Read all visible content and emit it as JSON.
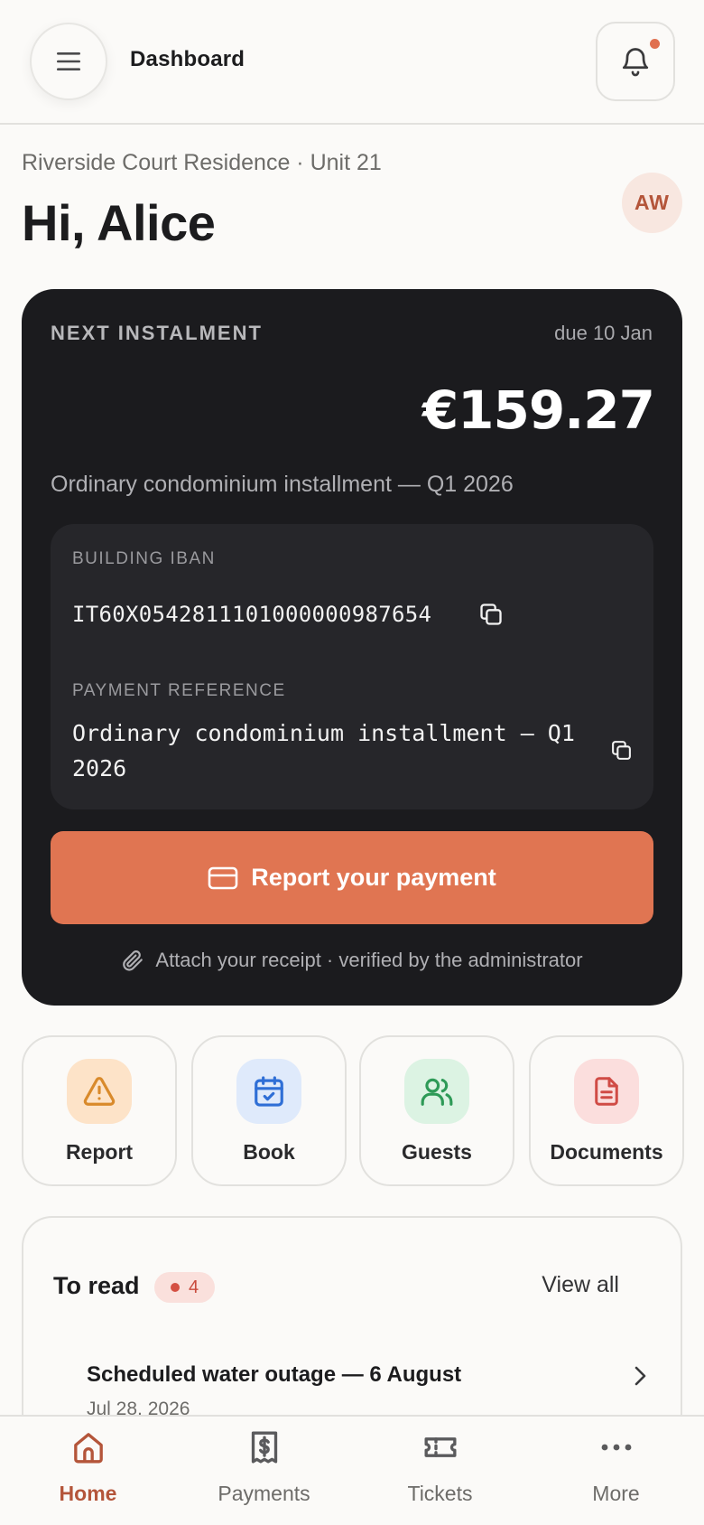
{
  "topbar": {
    "title": "Dashboard",
    "has_unread_notifications": true
  },
  "header": {
    "subtitle": "Riverside Court Residence · Unit 21",
    "greeting": "Hi, Alice",
    "avatar_initials": "AW"
  },
  "instalment": {
    "label": "NEXT INSTALMENT",
    "due": "due 10 Jan",
    "amount": "€159.27",
    "description": "Ordinary condominium installment — Q1 2026",
    "iban_label": "BUILDING IBAN",
    "iban": "IT60X0542811101000000987654",
    "reference_label": "PAYMENT REFERENCE",
    "reference": "Ordinary condominium installment — Q1 2026",
    "report_button": "Report your payment",
    "attach_note": "Attach your receipt · verified by the administrator"
  },
  "quick_actions": [
    {
      "label": "Report",
      "icon": "warning-icon",
      "bg": "#fde3c8",
      "fg": "#d98a2b"
    },
    {
      "label": "Book",
      "icon": "calendar-check-icon",
      "bg": "#dfeafb",
      "fg": "#2f6fd6"
    },
    {
      "label": "Guests",
      "icon": "users-icon",
      "bg": "#dcf3e3",
      "fg": "#2e9a57"
    },
    {
      "label": "Documents",
      "icon": "document-icon",
      "bg": "#fbdedd",
      "fg": "#d04b45"
    }
  ],
  "to_read": {
    "title": "To read",
    "count": "4",
    "view_all": "View all",
    "items": [
      {
        "title": "Scheduled water outage — 6 August",
        "date": "Jul 28, 2026"
      }
    ]
  },
  "bottom_nav": [
    {
      "label": "Home",
      "icon": "home-icon",
      "active": true
    },
    {
      "label": "Payments",
      "icon": "receipt-dollar-icon",
      "active": false
    },
    {
      "label": "Tickets",
      "icon": "ticket-icon",
      "active": false
    },
    {
      "label": "More",
      "icon": "more-dots-icon",
      "active": false
    }
  ],
  "colors": {
    "accent": "#e07552",
    "accent_dark": "#b4553a",
    "card_dark": "#1b1b1e",
    "background": "#fbfaf8"
  }
}
